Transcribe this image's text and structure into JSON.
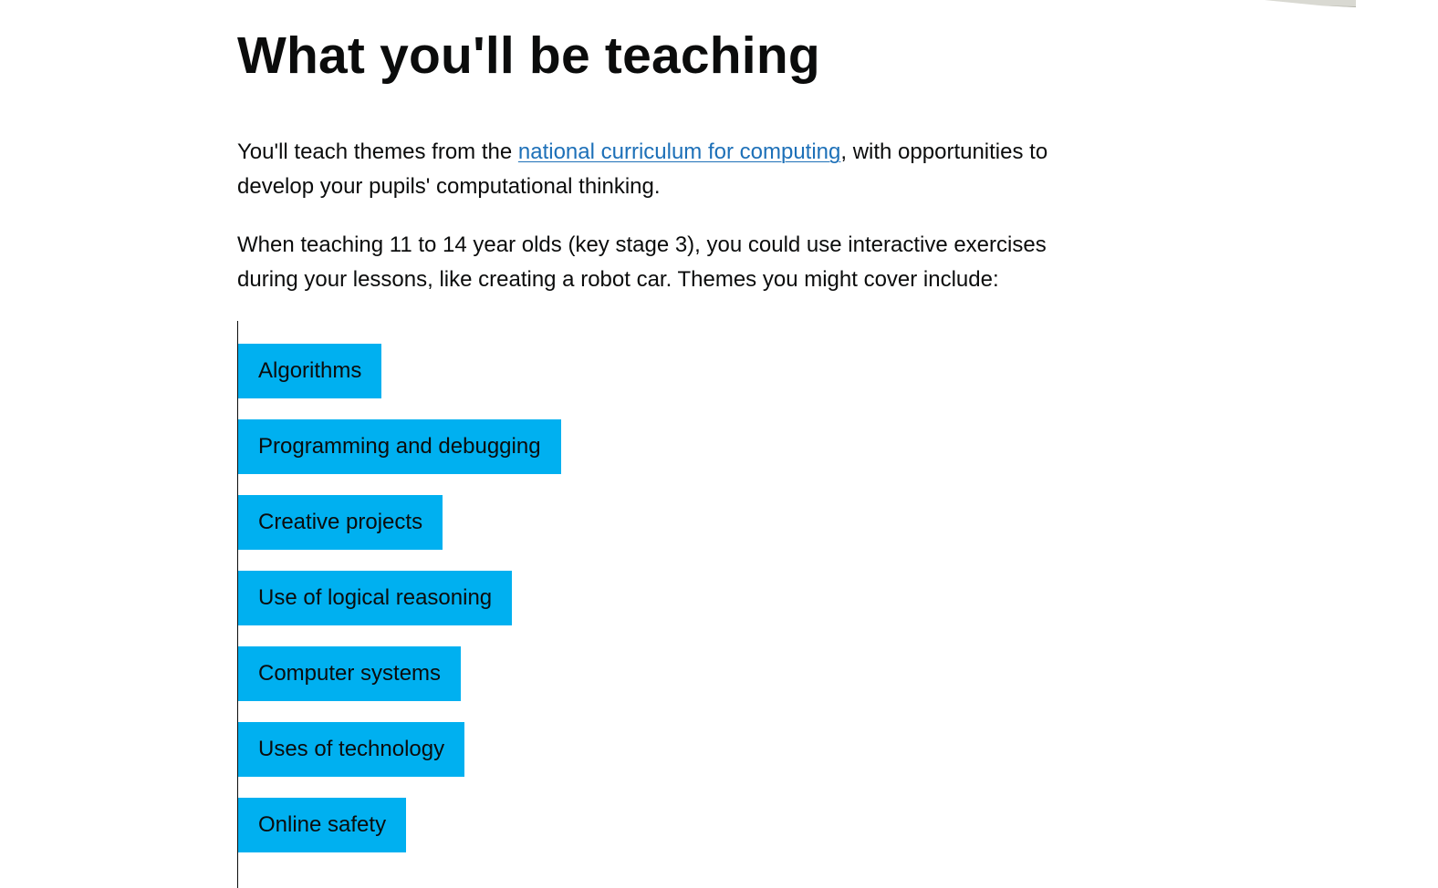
{
  "heading": "What you'll be teaching",
  "intro": {
    "before_link": "You'll teach themes from the ",
    "link_text": "national curriculum for computing",
    "after_link": ", with opportunities to develop your pupils' computational thinking."
  },
  "second_paragraph": "When teaching 11 to 14 year olds (key stage 3), you could use interactive exercises during your lessons, like creating a robot car. Themes you might cover include:",
  "themes": [
    "Algorithms",
    "Programming and debugging",
    "Creative projects",
    "Use of logical reasoning",
    "Computer systems",
    "Uses of technology",
    "Online safety"
  ],
  "colors": {
    "theme_background": "#00b0f0",
    "link": "#1d70b8",
    "text": "#0b0c0c"
  }
}
